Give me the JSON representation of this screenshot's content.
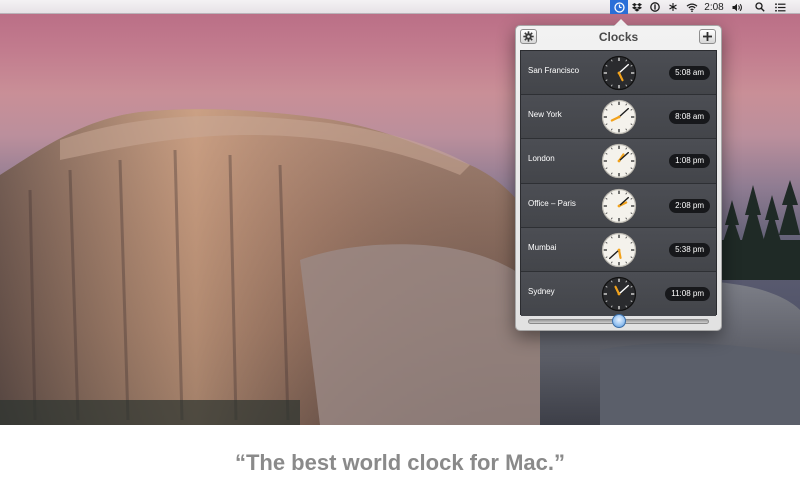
{
  "menubar": {
    "clock_time": "2:08",
    "icons": [
      "clocks-app-icon",
      "dropbox-icon",
      "onepassword-icon",
      "asterisk-icon",
      "wifi-icon",
      "volume-icon",
      "spotlight-search-icon",
      "notification-center-icon"
    ]
  },
  "popover": {
    "title": "Clocks",
    "settings_icon": "gear-icon",
    "add_icon": "plus-icon",
    "clocks": [
      {
        "city": "San Francisco",
        "time": "5:08 am",
        "hour": 5,
        "minute": 8,
        "night": true
      },
      {
        "city": "New York",
        "time": "8:08 am",
        "hour": 8,
        "minute": 8,
        "night": false
      },
      {
        "city": "London",
        "time": "1:08 pm",
        "hour": 1,
        "minute": 8,
        "night": false
      },
      {
        "city": "Office – Paris",
        "time": "2:08 pm",
        "hour": 2,
        "minute": 8,
        "night": false
      },
      {
        "city": "Mumbai",
        "time": "5:38 pm",
        "hour": 5,
        "minute": 38,
        "night": false
      },
      {
        "city": "Sydney",
        "time": "11:08 pm",
        "hour": 11,
        "minute": 8,
        "night": true
      }
    ],
    "time_slider_fraction": 0.5
  },
  "caption": "“The best world clock for Mac.”",
  "colors": {
    "menubar_active": "#2a6fd8",
    "clock_hand_accent": "#f2a21b",
    "list_background": "#45474c",
    "caption_text": "#8a8a8a"
  }
}
